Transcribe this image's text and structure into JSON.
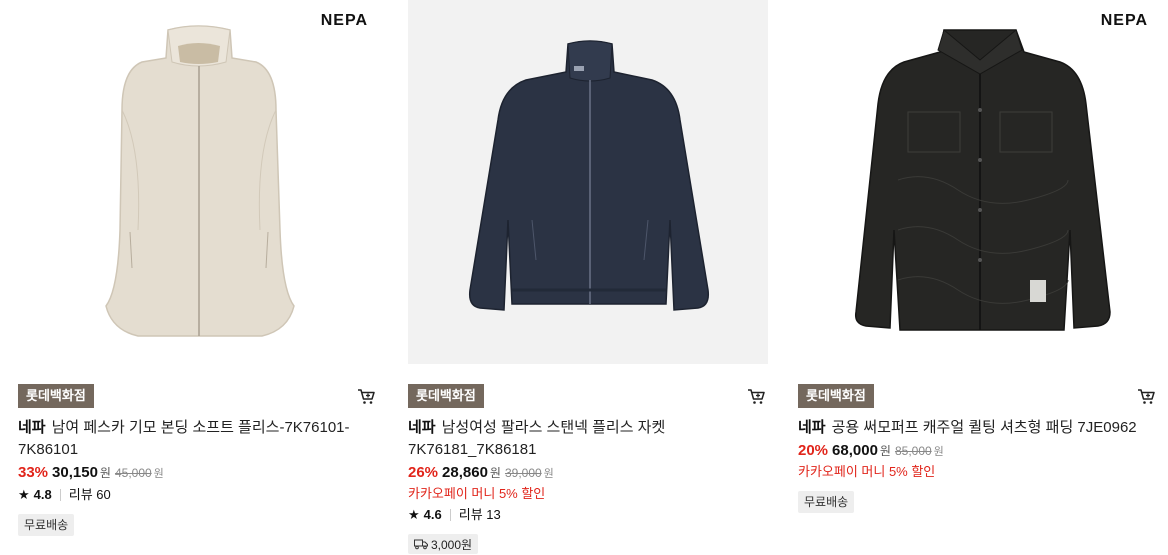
{
  "products": [
    {
      "logo": "NEPA",
      "store": "롯데백화점",
      "brand": "네파",
      "name": "남여 페스카 기모 본딩 소프트 플리스-7K76101-7K86101",
      "discount": "33%",
      "price": "30,150",
      "won": "원",
      "original_price": "45,000",
      "rating": "4.8",
      "reviews": "리뷰 60",
      "tag": "무료배송"
    },
    {
      "store": "롯데백화점",
      "brand": "네파",
      "name": "남성여성 팔라스 스탠넥 플리스 자켓 7K76181_7K86181",
      "discount": "26%",
      "price": "28,860",
      "won": "원",
      "original_price": "39,000",
      "promo": "카카오페이 머니 5% 할인",
      "rating": "4.6",
      "reviews": "리뷰 13",
      "shipping": "3,000원"
    },
    {
      "logo": "NEPA",
      "store": "롯데백화점",
      "brand": "네파",
      "name": "공용 써모퍼프 캐주얼 퀼팅 셔츠형 패딩 7JE0962",
      "discount": "20%",
      "price": "68,000",
      "won": "원",
      "original_price": "85,000",
      "promo": "카카오페이 머니 5% 할인",
      "tag": "무료배송"
    }
  ],
  "icons": {
    "cart": "cart-icon",
    "star": "star-icon",
    "truck": "truck-icon"
  },
  "colors": {
    "discount": "#e1251b",
    "store_badge": "#74685d"
  }
}
